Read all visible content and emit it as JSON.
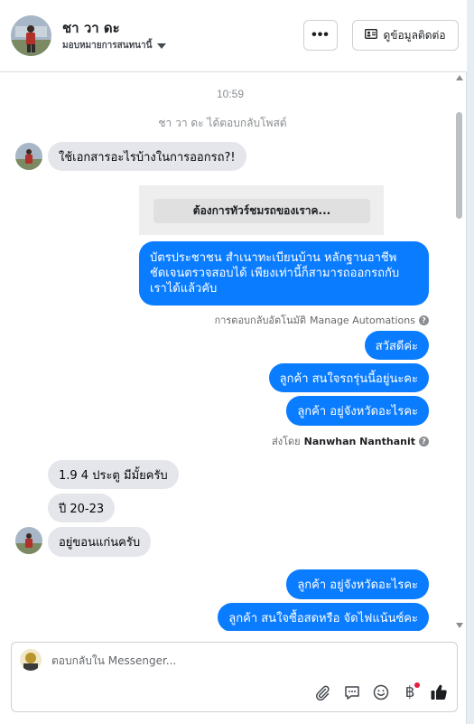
{
  "header": {
    "contact_name": "ชา วา ดะ",
    "assign_label": "มอบหมายการสนทนานี้",
    "more_label": "•••",
    "contact_info_label": "ดูข้อมูลติดต่อ"
  },
  "conversation": {
    "timestamp": "10:59",
    "system_note": "ชา วา ดะ ได้ตอบกลับโพสต์",
    "msg1": "ใช้เอกสารอะไรบ้างในการออกรถ?!",
    "template_button": "ต้องการทัวร์ชมรถของเราค...",
    "auto_reply_lines": [
      "บัตรประชาชน สำเนาทะเบียนบ้าน หลักฐานอาชีพ",
      "ชัดเจนตรวจสอบได้ เพียงเท่านี้ก็สามารถออกรถกับ",
      "เราได้แล้วคับ"
    ],
    "auto_meta_prefix": "การตอบกลับอัตโนมัติ",
    "auto_meta_link": "Manage Automations",
    "out1": "สวัสดีค่ะ",
    "out2": "ลูกค้า  สนใจรถรุ่นนี้อยู่นะคะ",
    "out3": "ลูกค้า  อยู่จังหวัดอะไรคะ",
    "sent_by_prefix": "ส่งโดย",
    "sent_by_name": "Nanwhan Nanthanit",
    "in2": "1.9 4 ประตู มีมั้ยครับ",
    "in3": "ปี 20-23",
    "in4": "อยู่ขอนแก่นครับ",
    "out4": "ลูกค้า  อยู่จังหวัดอะไรคะ",
    "out5": "ลูกค้า สนใจซื้อสดหรือ จัดไฟแน้นซ์คะ"
  },
  "composer": {
    "placeholder": "ตอบกลับใน Messenger..."
  },
  "colors": {
    "outgoing_bubble": "#0a7cff",
    "incoming_bubble": "#e4e6eb",
    "accent_badge": "#e41e3f"
  },
  "icons": {
    "more": "more-dots-icon",
    "contact": "contact-card-icon",
    "attach": "paperclip-icon",
    "saved_reply": "chat-bubble-icon",
    "emoji": "smiley-icon",
    "payment": "baht-icon",
    "like": "thumbs-up-icon"
  }
}
